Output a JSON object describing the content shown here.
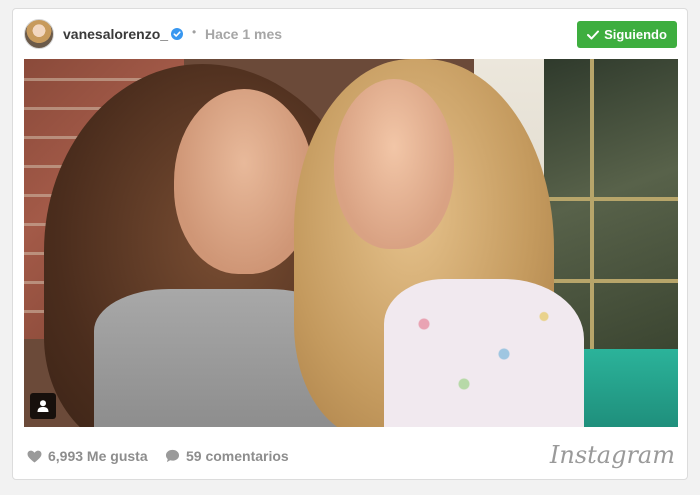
{
  "post": {
    "username": "vanesalorenzo_",
    "separator": "•",
    "time_ago": "Hace 1 mes",
    "follow_label": "Siguiendo",
    "likes_text": "6,993 Me gusta",
    "comments_text": "59 comentarios",
    "brand": "Instagram"
  },
  "colors": {
    "follow_button": "#3eae3f",
    "verified_badge": "#3897f0",
    "muted_text": "#8d8d8d"
  },
  "icons": {
    "verified": "verified-badge-icon",
    "check": "check-icon",
    "heart": "heart-icon",
    "comment": "comment-bubble-icon",
    "user_tag": "user-tag-icon"
  }
}
